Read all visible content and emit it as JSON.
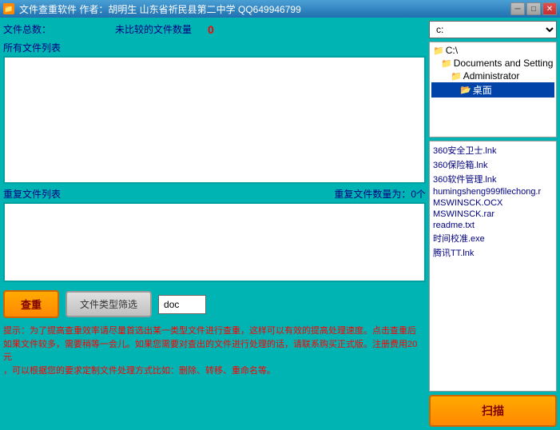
{
  "titlebar": {
    "title": "文件查重软件    作者：胡明生    山东省祈民县第二中学    QQ649946799",
    "icon": "📁",
    "minimize": "─",
    "maximize": "□",
    "close": "✕"
  },
  "left": {
    "file_count_label": "文件总数：",
    "uncompared_label": "未比较的文件数量",
    "uncompared_count": "0",
    "all_files_label": "所有文件列表",
    "dup_files_label": "重复文件列表",
    "dup_count_label": "重复文件数量为：0个",
    "btn_query": "查重",
    "btn_filter": "文件类型筛选",
    "file_type_value": "doc",
    "hint": "提示：为了提高查重效率请尽量首选出某一类型文件进行查重，这样可以有效的提高处理速度。点击查重后\n如果文件较多，需要稍等一会儿。如果您需要对查出的文件进行处理的话，请联系购买正式版。注册费用20元\n，可以根据您的要求定制文件处理方式比如：删除、转移、重命名等。"
  },
  "right": {
    "drive": "c:",
    "tree": [
      {
        "label": "C:\\",
        "indent": 0,
        "type": "folder"
      },
      {
        "label": "Documents and Setting",
        "indent": 1,
        "type": "folder"
      },
      {
        "label": "Administrator",
        "indent": 2,
        "type": "folder"
      },
      {
        "label": "桌面",
        "indent": 3,
        "type": "folder-open",
        "selected": true
      }
    ],
    "files": [
      "360安全卫士.lnk",
      "360保险箱.lnk",
      "360软件管理.lnk",
      "humingsheng999filechong.r",
      "MSWINSCK.OCX",
      "MSWINSCK.rar",
      "readme.txt",
      "时间校准.exe",
      "腾讯TT.lnk"
    ],
    "btn_scan": "扫描"
  }
}
